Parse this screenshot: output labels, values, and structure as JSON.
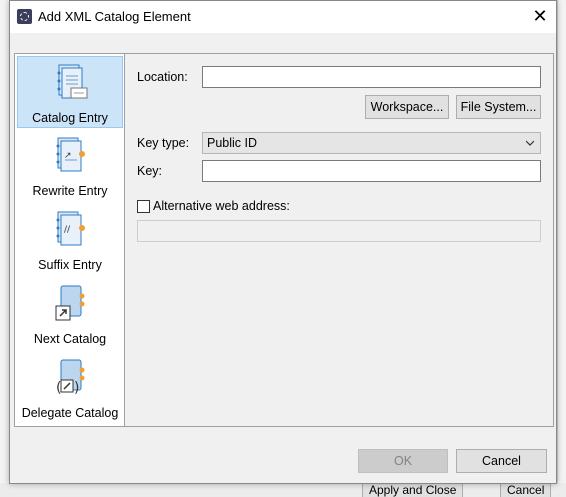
{
  "window": {
    "title": "Add XML Catalog Element",
    "close_glyph": "✕"
  },
  "sidebar": {
    "items": [
      {
        "label": "Catalog Entry",
        "icon": "catalog-entry-icon",
        "selected": true
      },
      {
        "label": "Rewrite Entry",
        "icon": "rewrite-entry-icon",
        "selected": false
      },
      {
        "label": "Suffix Entry",
        "icon": "suffix-entry-icon",
        "selected": false
      },
      {
        "label": "Next Catalog",
        "icon": "next-catalog-icon",
        "selected": false
      },
      {
        "label": "Delegate Catalog",
        "icon": "delegate-catalog-icon",
        "selected": false
      }
    ]
  },
  "form": {
    "location_label": "Location:",
    "location_value": "",
    "workspace_button": "Workspace...",
    "filesystem_button": "File System...",
    "key_type_label": "Key type:",
    "key_type_value": "Public ID",
    "key_label": "Key:",
    "key_value": "",
    "alt_web_label": "Alternative web address:",
    "alt_web_checked": false,
    "alt_web_value": ""
  },
  "footer": {
    "ok_label": "OK",
    "cancel_label": "Cancel"
  },
  "background": {
    "apply_close_label": "Apply and Close",
    "cancel_label": "Cancel"
  },
  "colors": {
    "selection_bg": "#cce4f7",
    "selection_border": "#99c9ef",
    "icon_blue": "#2c7bc4",
    "icon_orange": "#f0a030"
  }
}
